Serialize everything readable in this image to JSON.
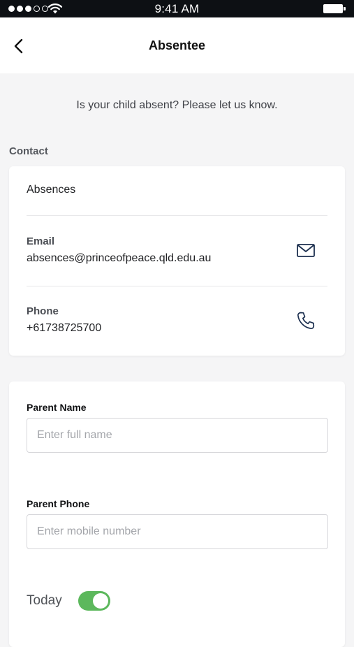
{
  "status_bar": {
    "time": "9:41 AM",
    "signal_filled": 3,
    "signal_total": 5
  },
  "header": {
    "title": "Absentee",
    "back_icon": "chevron-left-icon"
  },
  "intro": "Is your child absent? Please let us know.",
  "contact": {
    "section_title": "Contact",
    "heading": "Absences",
    "email": {
      "label": "Email",
      "value": "absences@princeofpeace.qld.edu.au",
      "icon": "mail-icon"
    },
    "phone": {
      "label": "Phone",
      "value": "+61738725700",
      "icon": "phone-icon"
    }
  },
  "form": {
    "parent_name": {
      "label": "Parent Name",
      "placeholder": "Enter full name",
      "value": ""
    },
    "parent_phone": {
      "label": "Parent Phone",
      "placeholder": "Enter mobile number",
      "value": ""
    },
    "today": {
      "label": "Today",
      "on": true
    }
  },
  "colors": {
    "status_bar_bg": "#0d1014",
    "page_bg": "#f5f5f6",
    "toggle_on": "#5cb85c",
    "icon_navy": "#1c2f4f"
  }
}
